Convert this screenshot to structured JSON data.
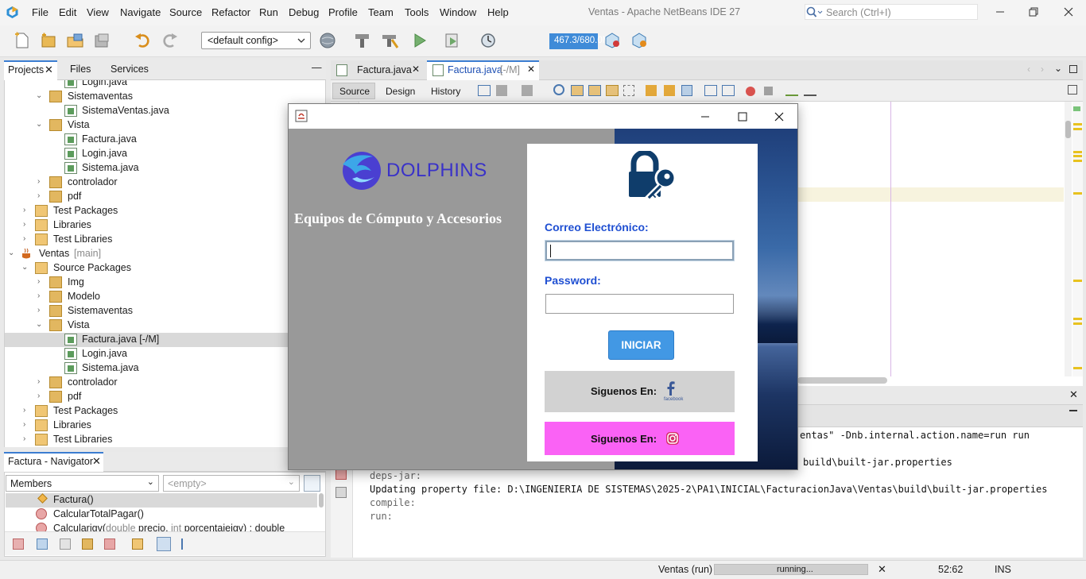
{
  "menubar": {
    "items": [
      "File",
      "Edit",
      "View",
      "Navigate",
      "Source",
      "Refactor",
      "Run",
      "Debug",
      "Profile",
      "Team",
      "Tools",
      "Window",
      "Help"
    ],
    "title": "Ventas - Apache NetBeans IDE 27",
    "search_placeholder": "Search (Ctrl+I)"
  },
  "toolbar": {
    "config": "<default config>",
    "memory": "467.3/680.0MB"
  },
  "projects": {
    "tabs": [
      "Projects",
      "Files",
      "Services"
    ],
    "rows": [
      "Login.java",
      "Sistemaventas",
      "SistemaVentas.java",
      "Vista",
      "Factura.java",
      "Login.java",
      "Sistema.java",
      "controlador",
      "pdf",
      "Test Packages",
      "Libraries",
      "Test Libraries",
      "Ventas",
      "[main]",
      "Source Packages",
      "Img",
      "Modelo",
      "Sistemaventas",
      "Vista",
      "Factura.java [-/M]",
      "Login.java",
      "Sistema.java",
      "controlador",
      "pdf",
      "Test Packages",
      "Libraries",
      "Test Libraries"
    ]
  },
  "navigator": {
    "title": "Factura - Navigator",
    "members_label": "Members",
    "filter_placeholder": "<empty>",
    "items": [
      "Factura()",
      "CalcularTotalPagar()",
      "Calcularigv(",
      "double",
      " precio, ",
      "int",
      " porcentajeigv) : double"
    ]
  },
  "editor": {
    "tabs": [
      "Factura.java",
      "Factura.java",
      "[-/M]"
    ],
    "subtabs": [
      "Source",
      "Design",
      "History"
    ]
  },
  "output": {
    "lines": [
      "entas\" -Dnb.internal.action.name=run run",
      "build\\built-jar.properties",
      "deps-jar:",
      "Updating property file: D:\\INGENIERIA DE SISTEMAS\\2025-2\\PA1\\INICIAL\\FacturacionJava\\Ventas\\build\\built-jar.properties",
      "compile:",
      "run:"
    ]
  },
  "status": {
    "task": "Ventas (run)",
    "progress_text": "running...",
    "position": "52:62",
    "mode": "INS"
  },
  "login": {
    "brand": "DOLPHINS",
    "tagline": "Equipos de Cómputo y Accesorios",
    "email_label": "Correo Electrónico:",
    "password_label": "Password:",
    "email_value": "",
    "password_value": "",
    "submit": "INICIAR",
    "follow_fb": "Siguenos En:",
    "fb_caption": "facebook",
    "follow_ig": "Siguenos En:"
  }
}
